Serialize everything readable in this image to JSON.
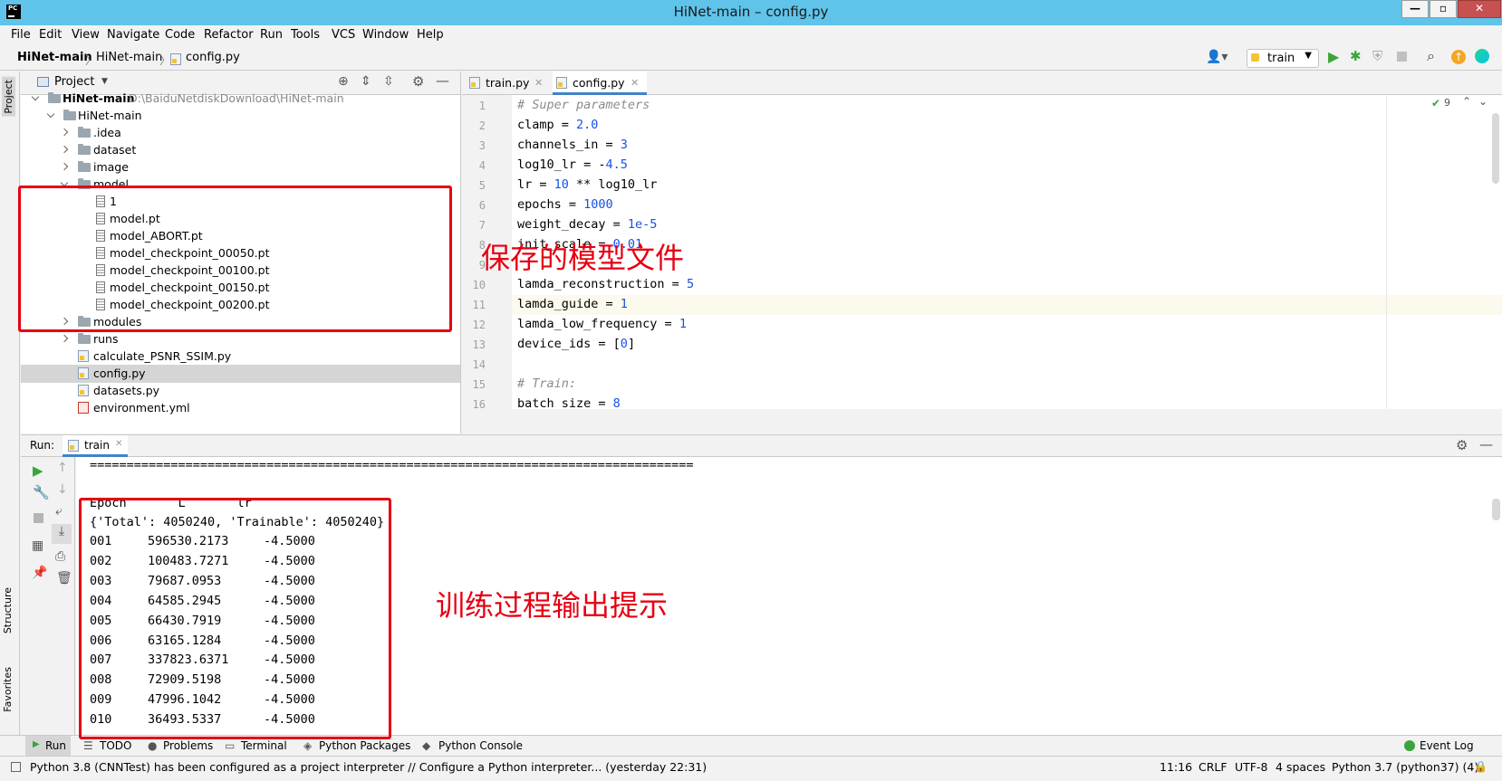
{
  "window": {
    "title": "HiNet-main – config.py",
    "logo_text": "PC"
  },
  "menu": [
    "File",
    "Edit",
    "View",
    "Navigate",
    "Code",
    "Refactor",
    "Run",
    "Tools",
    "VCS",
    "Window",
    "Help"
  ],
  "breadcrumb": [
    "HiNet-main",
    "HiNet-main",
    "config.py"
  ],
  "run_config": {
    "selected": "train"
  },
  "side_tabs": {
    "project": "Project",
    "structure": "Structure",
    "favorites": "Favorites"
  },
  "project_panel": {
    "title": "Project",
    "tree": [
      {
        "label": "HiNet-main",
        "path": "D:\\BaiduNetdiskDownload\\HiNet-main",
        "type": "root"
      },
      {
        "label": "HiNet-main",
        "type": "folder"
      },
      {
        "label": ".idea",
        "type": "folder"
      },
      {
        "label": "dataset",
        "type": "folder"
      },
      {
        "label": "image",
        "type": "folder"
      },
      {
        "label": "model",
        "type": "folder"
      },
      {
        "label": "1",
        "type": "file"
      },
      {
        "label": "model.pt",
        "type": "file"
      },
      {
        "label": "model_ABORT.pt",
        "type": "file"
      },
      {
        "label": "model_checkpoint_00050.pt",
        "type": "file"
      },
      {
        "label": "model_checkpoint_00100.pt",
        "type": "file"
      },
      {
        "label": "model_checkpoint_00150.pt",
        "type": "file"
      },
      {
        "label": "model_checkpoint_00200.pt",
        "type": "file"
      },
      {
        "label": "modules",
        "type": "folder"
      },
      {
        "label": "runs",
        "type": "folder"
      },
      {
        "label": "calculate_PSNR_SSIM.py",
        "type": "py"
      },
      {
        "label": "config.py",
        "type": "py",
        "selected": true
      },
      {
        "label": "datasets.py",
        "type": "py"
      },
      {
        "label": "environment.yml",
        "type": "yml"
      }
    ]
  },
  "editor": {
    "tabs": [
      {
        "label": "train.py",
        "active": false
      },
      {
        "label": "config.py",
        "active": true
      }
    ],
    "inspection_count": "9",
    "lines": [
      {
        "n": "1",
        "text": "# Super parameters"
      },
      {
        "n": "2",
        "text": "clamp = 2.0"
      },
      {
        "n": "3",
        "text": "channels_in = 3"
      },
      {
        "n": "4",
        "text": "log10_lr = -4.5"
      },
      {
        "n": "5",
        "text": "lr = 10 ** log10_lr"
      },
      {
        "n": "6",
        "text": "epochs = 1000"
      },
      {
        "n": "7",
        "text": "weight_decay = 1e-5"
      },
      {
        "n": "8",
        "text": "init_scale = 0.01"
      },
      {
        "n": "9",
        "text": ""
      },
      {
        "n": "10",
        "text": "lamda_reconstruction = 5"
      },
      {
        "n": "11",
        "text": "lamda_guide = 1"
      },
      {
        "n": "12",
        "text": "lamda_low_frequency = 1"
      },
      {
        "n": "13",
        "text": "device_ids = [0]"
      },
      {
        "n": "14",
        "text": ""
      },
      {
        "n": "15",
        "text": "# Train:"
      },
      {
        "n": "16",
        "text": "batch_size = 8"
      }
    ]
  },
  "run_panel": {
    "label": "Run:",
    "tab": "train",
    "separator": "==================================================================================",
    "header": "Epoch       L       lr",
    "params": "{'Total': 4050240, 'Trainable': 4050240}",
    "rows": [
      {
        "epoch": "001",
        "loss": "596530.2173",
        "lr": "-4.5000"
      },
      {
        "epoch": "002",
        "loss": "100483.7271",
        "lr": "-4.5000"
      },
      {
        "epoch": "003",
        "loss": "79687.0953",
        "lr": "-4.5000"
      },
      {
        "epoch": "004",
        "loss": "64585.2945",
        "lr": "-4.5000"
      },
      {
        "epoch": "005",
        "loss": "66430.7919",
        "lr": "-4.5000"
      },
      {
        "epoch": "006",
        "loss": "63165.1284",
        "lr": "-4.5000"
      },
      {
        "epoch": "007",
        "loss": "337823.6371",
        "lr": "-4.5000"
      },
      {
        "epoch": "008",
        "loss": "72909.5198",
        "lr": "-4.5000"
      },
      {
        "epoch": "009",
        "loss": "47996.1042",
        "lr": "-4.5000"
      },
      {
        "epoch": "010",
        "loss": "36493.5337",
        "lr": "-4.5000"
      }
    ]
  },
  "bottom_tabs": [
    "Run",
    "TODO",
    "Problems",
    "Terminal",
    "Python Packages",
    "Python Console"
  ],
  "event_log": "Event Log",
  "status": {
    "message": "Python 3.8 (CNNTest) has been configured as a project interpreter // Configure a Python interpreter... (yesterday 22:31)",
    "position": "11:16",
    "line_sep": "CRLF",
    "encoding": "UTF-8",
    "indent": "4 spaces",
    "interpreter": "Python 3.7 (python37) (4)"
  },
  "annotations": {
    "model_files": "保存的模型文件",
    "training_output": "训练过程输出提示"
  },
  "colors": {
    "annotation_red": "#e60012",
    "titlebar": "#5fc3ea",
    "accent": "#4083c9"
  }
}
